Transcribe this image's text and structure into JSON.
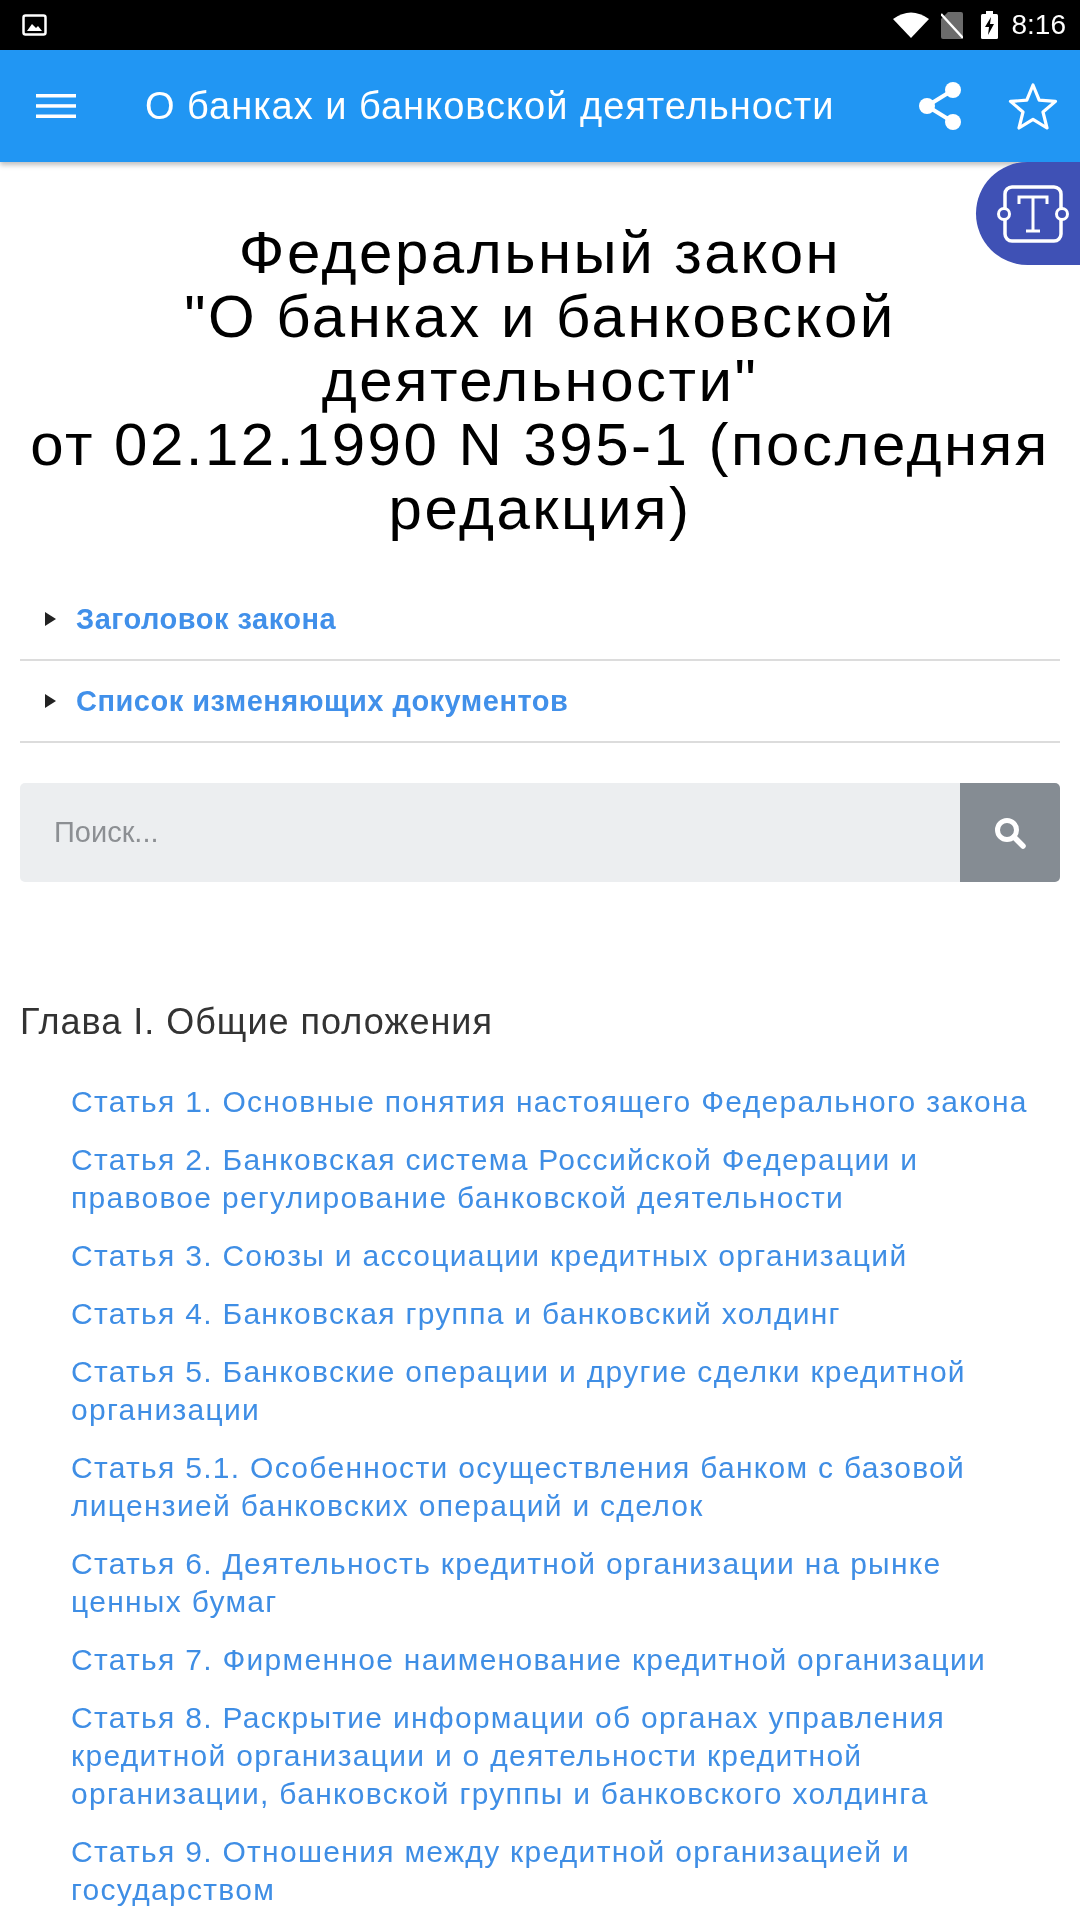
{
  "status_bar": {
    "time": "8:16"
  },
  "app_bar": {
    "title": "О банках и банковской деятельности"
  },
  "document": {
    "title": "Федеральный закон\n\"О банках и банковской деятельности\"\nот 02.12.1990 N 395-1 (последняя редакция)",
    "sections": [
      {
        "label": "Заголовок закона",
        "expanded": false
      },
      {
        "label": "Список изменяющих документов",
        "expanded": false
      }
    ]
  },
  "search": {
    "placeholder": "Поиск..."
  },
  "chapters": [
    {
      "title": "Глава I. Общие положения",
      "articles": [
        "Статья 1. Основные понятия настоящего Федерального закона",
        "Статья 2. Банковская система Российской Федерации и правовое регулирование банковской деятельности",
        "Статья 3. Союзы и ассоциации кредитных организаций",
        "Статья 4. Банковская группа и банковский холдинг",
        "Статья 5. Банковские операции и другие сделки кредитной организации",
        "Статья 5.1. Особенности осуществления банком с базовой лицензией банковских операций и сделок",
        "Статья 6. Деятельность кредитной организации на рынке ценных бумаг",
        "Статья 7. Фирменное наименование кредитной организации",
        "Статья 8. Раскрытие информации об органах управления кредитной организации и о деятельности кредитной организации, банковской группы и банковского холдинга",
        "Статья 9. Отношения между кредитной организацией и государством"
      ]
    }
  ]
}
